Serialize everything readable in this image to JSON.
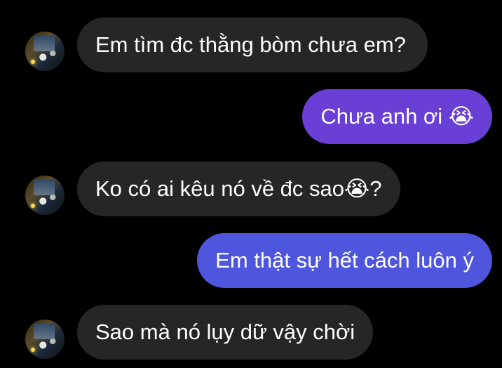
{
  "messages": [
    {
      "sender": "other",
      "text": "Em tìm đc thằng bòm chưa em?",
      "emoji": "",
      "suffix": ""
    },
    {
      "sender": "me",
      "text": "Chưa anh ơi ",
      "emoji": "😭",
      "suffix": ""
    },
    {
      "sender": "other",
      "text": "Ko có ai kêu nó về đc sao",
      "emoji": "😭",
      "suffix": "?"
    },
    {
      "sender": "me",
      "text": "Em thật sự hết cách luôn ý",
      "emoji": "",
      "suffix": ""
    },
    {
      "sender": "other",
      "text": "Sao mà nó lụy dữ vậy chời",
      "emoji": "",
      "suffix": ""
    }
  ],
  "colors": {
    "background": "#000000",
    "incoming_bubble": "#262626",
    "outgoing_bubble_1": "#6a3fd6",
    "outgoing_bubble_2": "#4f56de"
  },
  "icons": {
    "avatar": "profile-photo"
  }
}
